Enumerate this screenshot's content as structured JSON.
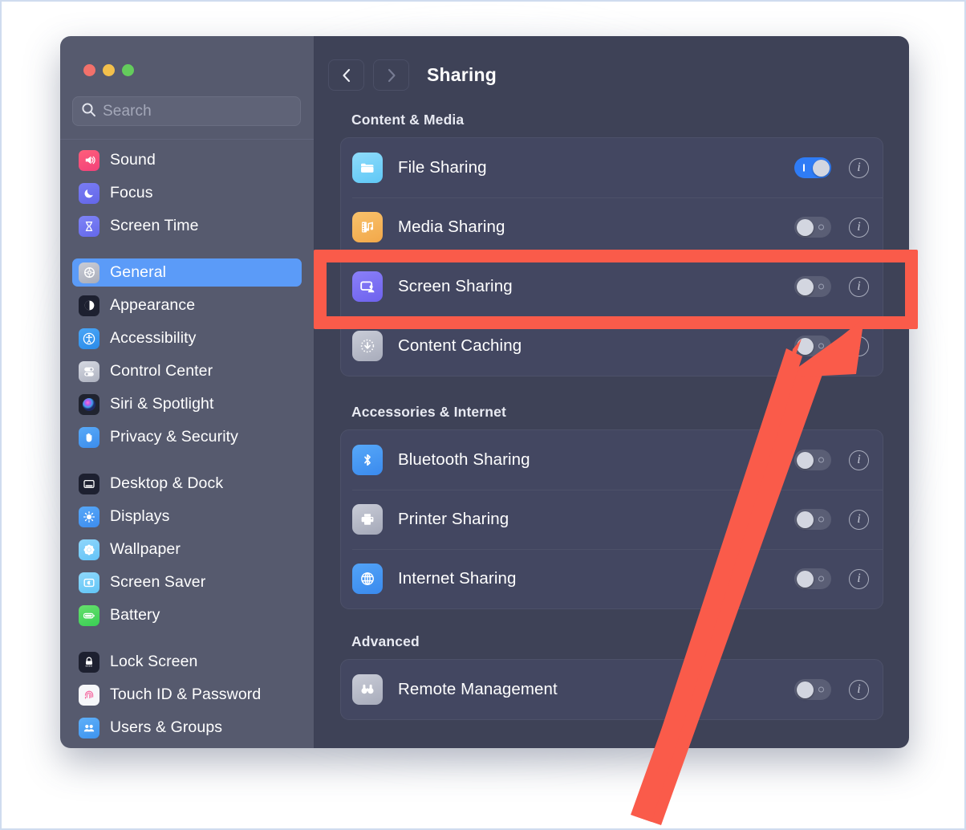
{
  "window": {
    "traffic_lights": [
      "close",
      "minimize",
      "zoom"
    ],
    "colors": {
      "sidebar_bg": "#565a6e",
      "main_bg": "#3e4257",
      "card_bg": "#434761",
      "accent_selected": "#5b9bf8",
      "toggle_on": "#2f7cf6",
      "annotation_red": "#fa5b4a"
    }
  },
  "sidebar": {
    "search": {
      "placeholder": "Search",
      "value": "",
      "icon": "search-icon"
    },
    "items": [
      {
        "label": "Sound",
        "icon": "sound-icon",
        "selected": false
      },
      {
        "label": "Focus",
        "icon": "focus-moon-icon",
        "selected": false
      },
      {
        "label": "Screen Time",
        "icon": "hourglass-icon",
        "selected": false
      },
      {
        "label": "General",
        "icon": "gear-icon",
        "selected": true
      },
      {
        "label": "Appearance",
        "icon": "appearance-icon",
        "selected": false
      },
      {
        "label": "Accessibility",
        "icon": "accessibility-icon",
        "selected": false
      },
      {
        "label": "Control Center",
        "icon": "control-center-icon",
        "selected": false
      },
      {
        "label": "Siri & Spotlight",
        "icon": "siri-icon",
        "selected": false
      },
      {
        "label": "Privacy & Security",
        "icon": "hand-shield-icon",
        "selected": false
      },
      {
        "label": "Desktop & Dock",
        "icon": "desktop-dock-icon",
        "selected": false
      },
      {
        "label": "Displays",
        "icon": "brightness-icon",
        "selected": false
      },
      {
        "label": "Wallpaper",
        "icon": "wallpaper-icon",
        "selected": false
      },
      {
        "label": "Screen Saver",
        "icon": "screen-saver-icon",
        "selected": false
      },
      {
        "label": "Battery",
        "icon": "battery-icon",
        "selected": false
      },
      {
        "label": "Lock Screen",
        "icon": "lock-icon",
        "selected": false
      },
      {
        "label": "Touch ID & Password",
        "icon": "fingerprint-icon",
        "selected": false
      },
      {
        "label": "Users & Groups",
        "icon": "users-icon",
        "selected": false
      }
    ]
  },
  "toolbar": {
    "back_label": "‹",
    "forward_label": "›",
    "title": "Sharing"
  },
  "sections": [
    {
      "header": "Content & Media",
      "rows": [
        {
          "label": "File Sharing",
          "icon": "folder-icon",
          "toggle": "on",
          "info": "i"
        },
        {
          "label": "Media Sharing",
          "icon": "media-note-icon",
          "toggle": "off",
          "info": "i"
        },
        {
          "label": "Screen Sharing",
          "icon": "screen-sharing-icon",
          "toggle": "off",
          "info": "i"
        },
        {
          "label": "Content Caching",
          "icon": "download-arrow-icon",
          "toggle": "off",
          "info": "i"
        }
      ]
    },
    {
      "header": "Accessories & Internet",
      "rows": [
        {
          "label": "Bluetooth Sharing",
          "icon": "bluetooth-icon",
          "toggle": "off",
          "info": "i"
        },
        {
          "label": "Printer Sharing",
          "icon": "printer-icon",
          "toggle": "off",
          "info": "i"
        },
        {
          "label": "Internet Sharing",
          "icon": "globe-icon",
          "toggle": "off",
          "info": "i"
        }
      ]
    },
    {
      "header": "Advanced",
      "rows": [
        {
          "label": "Remote Management",
          "icon": "binoculars-icon",
          "toggle": "off",
          "info": "i"
        }
      ]
    }
  ],
  "annotations": {
    "highlight_target": "Screen Sharing",
    "arrow_points_to": "screen-sharing-info-button",
    "color": "#fa5b4a"
  }
}
